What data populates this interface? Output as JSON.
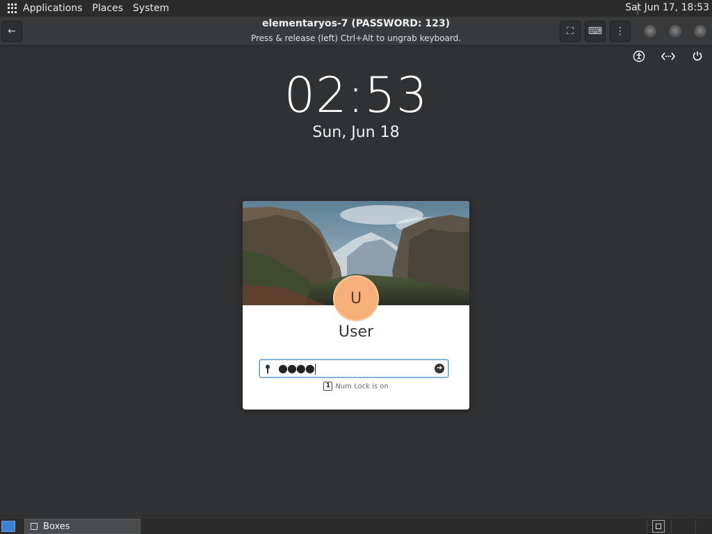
{
  "top_panel": {
    "menus": [
      "Applications",
      "Places",
      "System"
    ],
    "clock": "Sat Jun 17, 18:53",
    "icons": [
      "apps-grid-icon"
    ]
  },
  "headerbar": {
    "title": "elementaryos-7 (PASSWORD: 123)",
    "subtitle": "Press & release (left) Ctrl+Alt to ungrab keyboard.",
    "back_icon": "←",
    "fullscreen_icon": "⛶",
    "keyboard_icon": "⌨",
    "menu_icon": "⋮"
  },
  "lock_screen": {
    "time": "02:53",
    "date": "Sun, Jun 18",
    "tray_icons": {
      "accessibility": "accessibility-icon",
      "network": "network-icon",
      "power": "power-icon"
    },
    "card": {
      "avatar_letter": "U",
      "username": "User",
      "password_masked": "●●●●",
      "numlock_text": "Num Lock is on",
      "numlock_badge": "1",
      "submit_icon": "➜"
    }
  },
  "bottom_panel": {
    "task_label": "Boxes"
  },
  "colors": {
    "background": "#2f3133",
    "panel": "#2b2b2b",
    "avatar": "#f8b07a",
    "focus": "#5b9bd6"
  }
}
